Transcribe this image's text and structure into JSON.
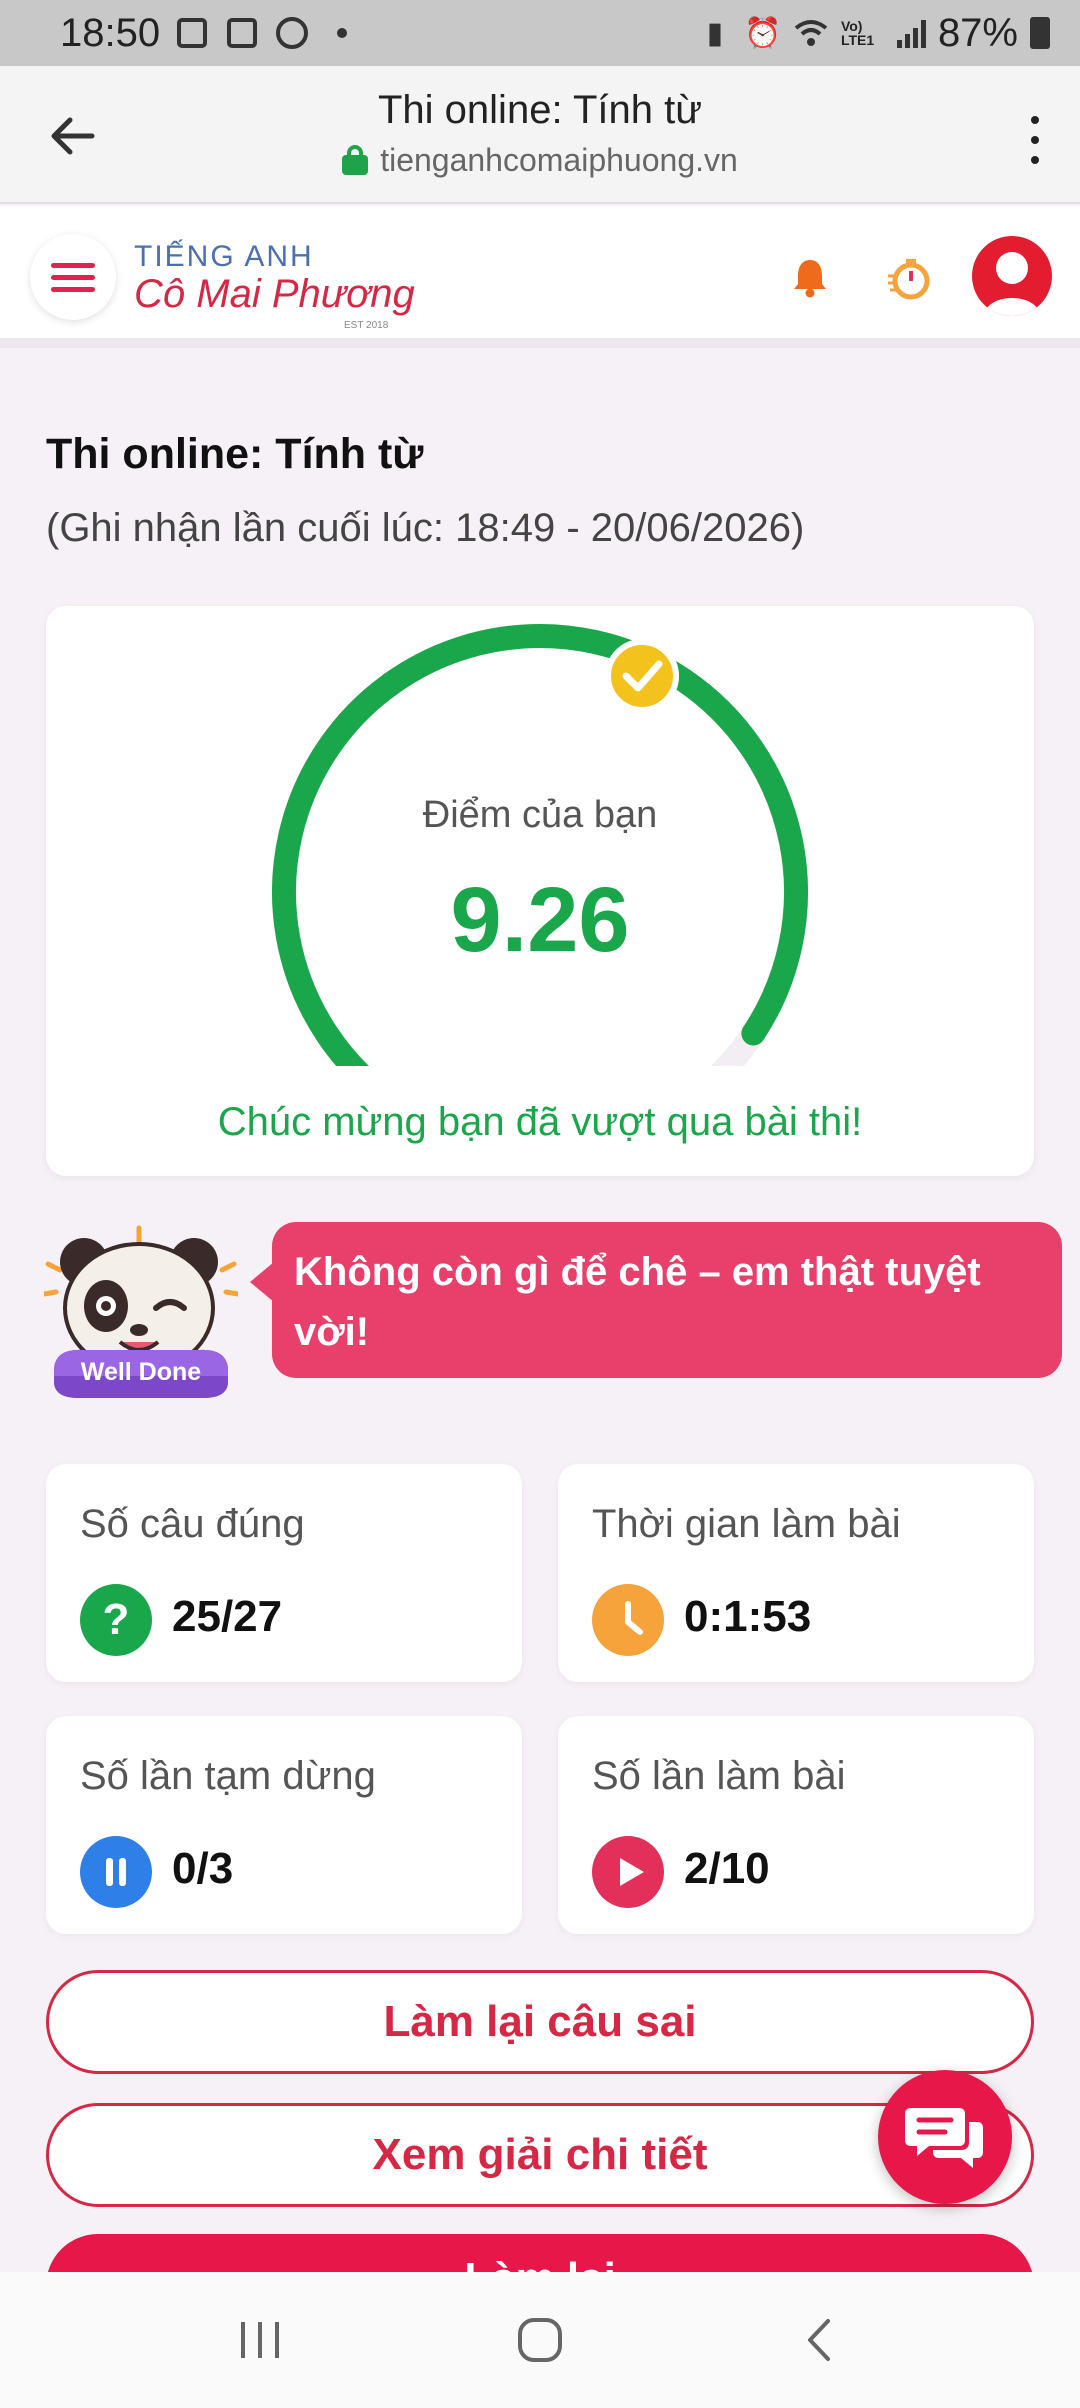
{
  "status_bar": {
    "time": "18:50",
    "battery": "87%",
    "network": "Vo) LTE1"
  },
  "browser": {
    "page_title": "Thi online: Tính từ",
    "domain": "tienganhcomaiphuong.vn"
  },
  "site_header": {
    "logo_top": "TIẾNG ANH",
    "logo_bottom": "Cô Mai Phương",
    "logo_est": "EST 2018"
  },
  "exam": {
    "title": "Thi online: Tính từ",
    "last_record": "(Ghi nhận lần cuối lúc: 18:49 - 20/06/2026)"
  },
  "score_card": {
    "label": "Điểm của bạn",
    "score": "9.26",
    "score_max": 10,
    "message": "Chúc mừng bạn đã vượt qua bài thi!"
  },
  "praise": {
    "badge_text": "Well Done",
    "message": "Không còn gì để chê – em thật tuyệt vời!"
  },
  "stats": {
    "correct": {
      "label": "Số câu đúng",
      "value": "25/27",
      "icon": "question-icon",
      "color": "#1aa64a"
    },
    "time": {
      "label": "Thời gian làm bài",
      "value": "0:1:53",
      "icon": "clock-icon",
      "color": "#f5a33a"
    },
    "pauses": {
      "label": "Số lần tạm dừng",
      "value": "0/3",
      "icon": "pause-icon",
      "color": "#2f7fe8"
    },
    "attempts": {
      "label": "Số lần làm bài",
      "value": "2/10",
      "icon": "play-icon",
      "color": "#e2305a"
    }
  },
  "actions": {
    "redo_wrong": "Làm lại câu sai",
    "view_solution": "Xem giải chi tiết",
    "retry_partial": "Làm lại"
  },
  "colors": {
    "brand": "#d62845",
    "success": "#1aa64a",
    "bubble": "#e8406b"
  }
}
